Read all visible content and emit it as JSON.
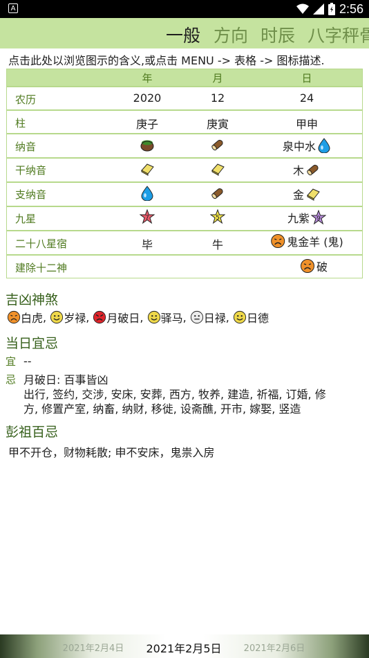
{
  "status": {
    "time": "2:56",
    "left_icon": "A"
  },
  "tabs": [
    "一般",
    "方向",
    "时辰",
    "八字秤骨"
  ],
  "hint": "点击此处以浏览图示的含义,或点击 MENU -> 表格 -> 图标描述.",
  "table": {
    "headers": [
      "年",
      "月",
      "日"
    ],
    "rows": {
      "nongli": {
        "label": "农历",
        "year": "2020",
        "month": "12",
        "day": "24"
      },
      "zhu": {
        "label": "柱",
        "year": "庚子",
        "month": "庚寅",
        "day": "甲申"
      },
      "nayin": {
        "label": "纳音",
        "day": "泉中水"
      },
      "gannayin": {
        "label": "干纳音",
        "day": "木"
      },
      "zhinayin": {
        "label": "支纳音",
        "day": "金"
      },
      "jiuxing": {
        "label": "九星",
        "day": "九紫"
      },
      "xiu": {
        "label": "二十八星宿",
        "year": "毕",
        "month": "牛",
        "day": "鬼金羊 (鬼)"
      },
      "jianchu": {
        "label": "建除十二神",
        "day": "破"
      }
    },
    "star_numbers": {
      "year": "7",
      "month": "5",
      "day": "9"
    }
  },
  "jixiong": {
    "title": "吉凶神煞",
    "items": [
      "白虎",
      "岁禄",
      "月破日",
      "驿马",
      "日禄",
      "日德"
    ]
  },
  "yiji": {
    "title": "当日宜忌",
    "yi_label": "宜",
    "yi_value": "--",
    "ji_label": "忌",
    "ji_line1": "月破日: 百事皆凶",
    "ji_line2": "出行, 签约, 交涉, 安床, 安葬, 西方, 牧养, 建造, 祈福, 订婚, 修",
    "ji_line3": "方, 修置产室, 纳畜, 纳财, 移徙, 设斋醮, 开市, 嫁娶, 竖造"
  },
  "pengzu": {
    "title": "彭祖百忌",
    "text": "甲不开仓，财物耗散; 申不安床，鬼祟入房"
  },
  "datebar": {
    "prev": "2021年2月4日",
    "current": "2021年2月5日",
    "next": "2021年2月6日"
  },
  "colors": {
    "header_green": "#c5e39f",
    "border_green": "#b7d98c",
    "label_green": "#4f7a1f"
  }
}
